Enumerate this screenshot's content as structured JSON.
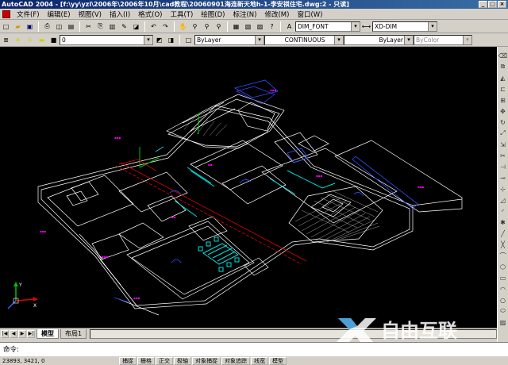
{
  "window": {
    "title": "AutoCAD 2004 - [f:\\yy\\yzl\\2006年\\2006年10月\\cad教程\\20060901海连新天地h-1-李安祺住宅.dwg:2 - 只读]",
    "buttons": [
      "_",
      "□",
      "×"
    ]
  },
  "menu": [
    "文件(F)",
    "编辑(E)",
    "视图(V)",
    "插入(I)",
    "格式(O)",
    "工具(T)",
    "绘图(D)",
    "标注(N)",
    "修改(M)",
    "窗口(W)"
  ],
  "toolbar1": {
    "text_style": "DIM_FONT",
    "dim_style": "XD-DIM"
  },
  "toolbar2": {
    "layer": "0",
    "color": "ByLayer",
    "linetype": "CONTINUOUS",
    "lineweight": "ByLayer",
    "plotstyle": "ByColor"
  },
  "canvas": {
    "background": "#000000",
    "ucs_labels": [
      "Y",
      "X"
    ]
  },
  "tabs": [
    "模型",
    "布局1"
  ],
  "command": {
    "prompt": "命令:"
  },
  "status": {
    "coords": "23893, 3421, 0",
    "buttons": [
      "捕捉",
      "栅格",
      "正交",
      "极轴",
      "对象捕捉",
      "对象追踪",
      "线宽",
      "模型"
    ]
  },
  "watermark": {
    "text": "自由互联"
  },
  "colors": {
    "titlebar": "#0a246a",
    "canvas": "#000000",
    "chrome": "#d4d0c8"
  }
}
